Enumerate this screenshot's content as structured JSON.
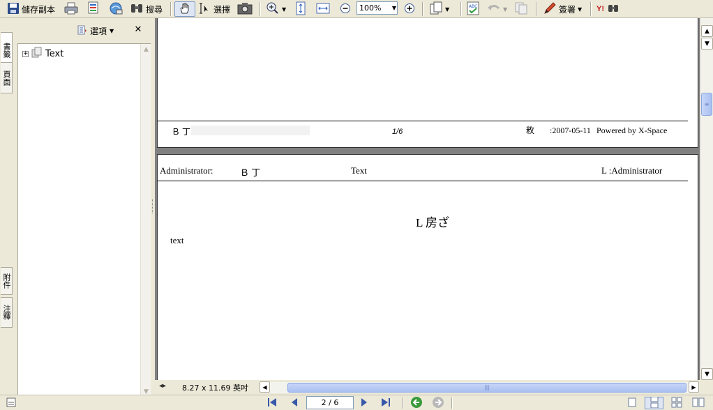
{
  "toolbar": {
    "save_copy_label": "儲存副本",
    "search_label": "搜尋",
    "select_label": "選擇",
    "zoom_value": "100%",
    "sign_label": "簽署"
  },
  "nav_tabs": {
    "bookmarks": "書籤",
    "pages": "頁面",
    "attachments": "附件",
    "comments": "注釋"
  },
  "sidebar": {
    "options_label": "選項",
    "tree_items": [
      {
        "label": "Text"
      }
    ]
  },
  "document": {
    "page1_footer": {
      "left": "Ｂ 丁:",
      "page_num": "1/6",
      "mid_right": "敉",
      "date": ":2007-05-11",
      "powered_by": "Powered by X-Space"
    },
    "page2_header": {
      "user": "Administrator:",
      "mid": "Ｂ 丁",
      "title": "Text",
      "right": "L :Administrator"
    },
    "page2_body": {
      "heading": "L 房ざ",
      "text": "text"
    }
  },
  "doc_bottom": {
    "page_size": "8.27 x 11.69 英吋"
  },
  "statusbar": {
    "page_indicator": "2 / 6"
  }
}
